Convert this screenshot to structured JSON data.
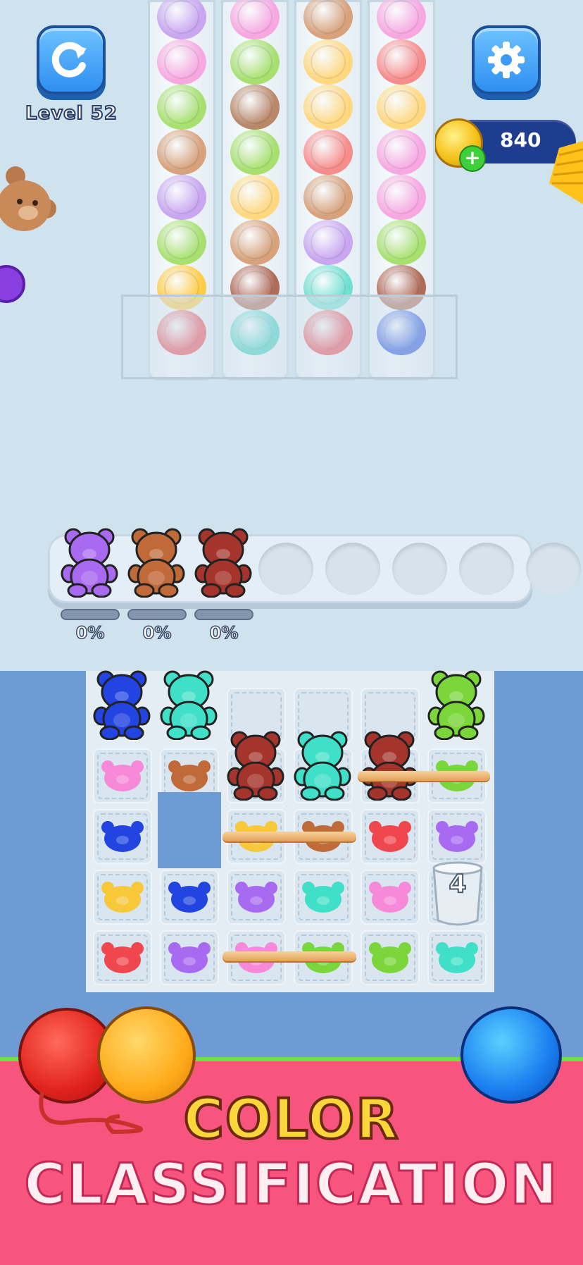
{
  "hud": {
    "level_label": "Level 52",
    "coins": "840",
    "coin_plus": "+"
  },
  "tubes": [
    {
      "balls": [
        "#c9a6f0",
        "#f7a8e0",
        "#a8e070",
        "#d7a27c",
        "#c9a6f0",
        "#a8e070",
        "#ffcc44",
        "#ef4a54"
      ]
    },
    {
      "balls": [
        "#f7a8e0",
        "#a8e070",
        "#b9876a",
        "#a8e070",
        "#ffd880",
        "#d7a27c",
        "#b06a58",
        "#3fd0c2"
      ]
    },
    {
      "balls": [
        "#d7a27c",
        "#ffd880",
        "#ffd880",
        "#f78c8c",
        "#d7a27c",
        "#c9a6f0",
        "#70e0d0",
        "#ef4a54"
      ]
    },
    {
      "balls": [
        "#f7a8e0",
        "#f78c8c",
        "#ffd880",
        "#f7a8e0",
        "#f7a8e0",
        "#a8e070",
        "#b06a58",
        "#2c55e0"
      ]
    }
  ],
  "collector": {
    "bears": [
      "#a86af0",
      "#c06a3a",
      "#a5352c"
    ],
    "empty_slots": 5,
    "progress": [
      "0%",
      "0%",
      "0%"
    ]
  },
  "board": {
    "top_bears": [
      {
        "col": 0,
        "color": "#2244e0"
      },
      {
        "col": 1,
        "color": "#40e0c8"
      },
      {
        "col": 5,
        "color": "#7ad63a"
      }
    ],
    "mid_bears": [
      {
        "col": 2,
        "color": "#a5352c"
      },
      {
        "col": 3,
        "color": "#40e0c8"
      },
      {
        "col": 4,
        "color": "#a5352c"
      }
    ],
    "heads": [
      {
        "row": 1,
        "col": 0,
        "color": "#f78ad8"
      },
      {
        "row": 1,
        "col": 1,
        "color": "#c06a3a"
      },
      {
        "row": 1,
        "col": 5,
        "color": "#7ad63a"
      },
      {
        "row": 2,
        "col": 0,
        "color": "#2244e0"
      },
      {
        "row": 2,
        "col": 2,
        "color": "#f7c83a"
      },
      {
        "row": 2,
        "col": 3,
        "color": "#c06a3a"
      },
      {
        "row": 2,
        "col": 4,
        "color": "#f0474f"
      },
      {
        "row": 2,
        "col": 5,
        "color": "#a86af0"
      },
      {
        "row": 3,
        "col": 0,
        "color": "#f7c83a"
      },
      {
        "row": 3,
        "col": 1,
        "color": "#2244e0"
      },
      {
        "row": 3,
        "col": 2,
        "color": "#a86af0"
      },
      {
        "row": 3,
        "col": 3,
        "color": "#40e0c8"
      },
      {
        "row": 3,
        "col": 4,
        "color": "#f78ad8"
      },
      {
        "row": 4,
        "col": 0,
        "color": "#f0474f"
      },
      {
        "row": 4,
        "col": 1,
        "color": "#a86af0"
      },
      {
        "row": 4,
        "col": 2,
        "color": "#f78ad8"
      },
      {
        "row": 4,
        "col": 3,
        "color": "#7ad63a"
      },
      {
        "row": 4,
        "col": 4,
        "color": "#7ad63a"
      },
      {
        "row": 4,
        "col": 5,
        "color": "#40e0c8"
      }
    ],
    "cup_count": "4"
  },
  "banner": {
    "line1": "COLOR",
    "line2": "CLASSIFICATION"
  }
}
